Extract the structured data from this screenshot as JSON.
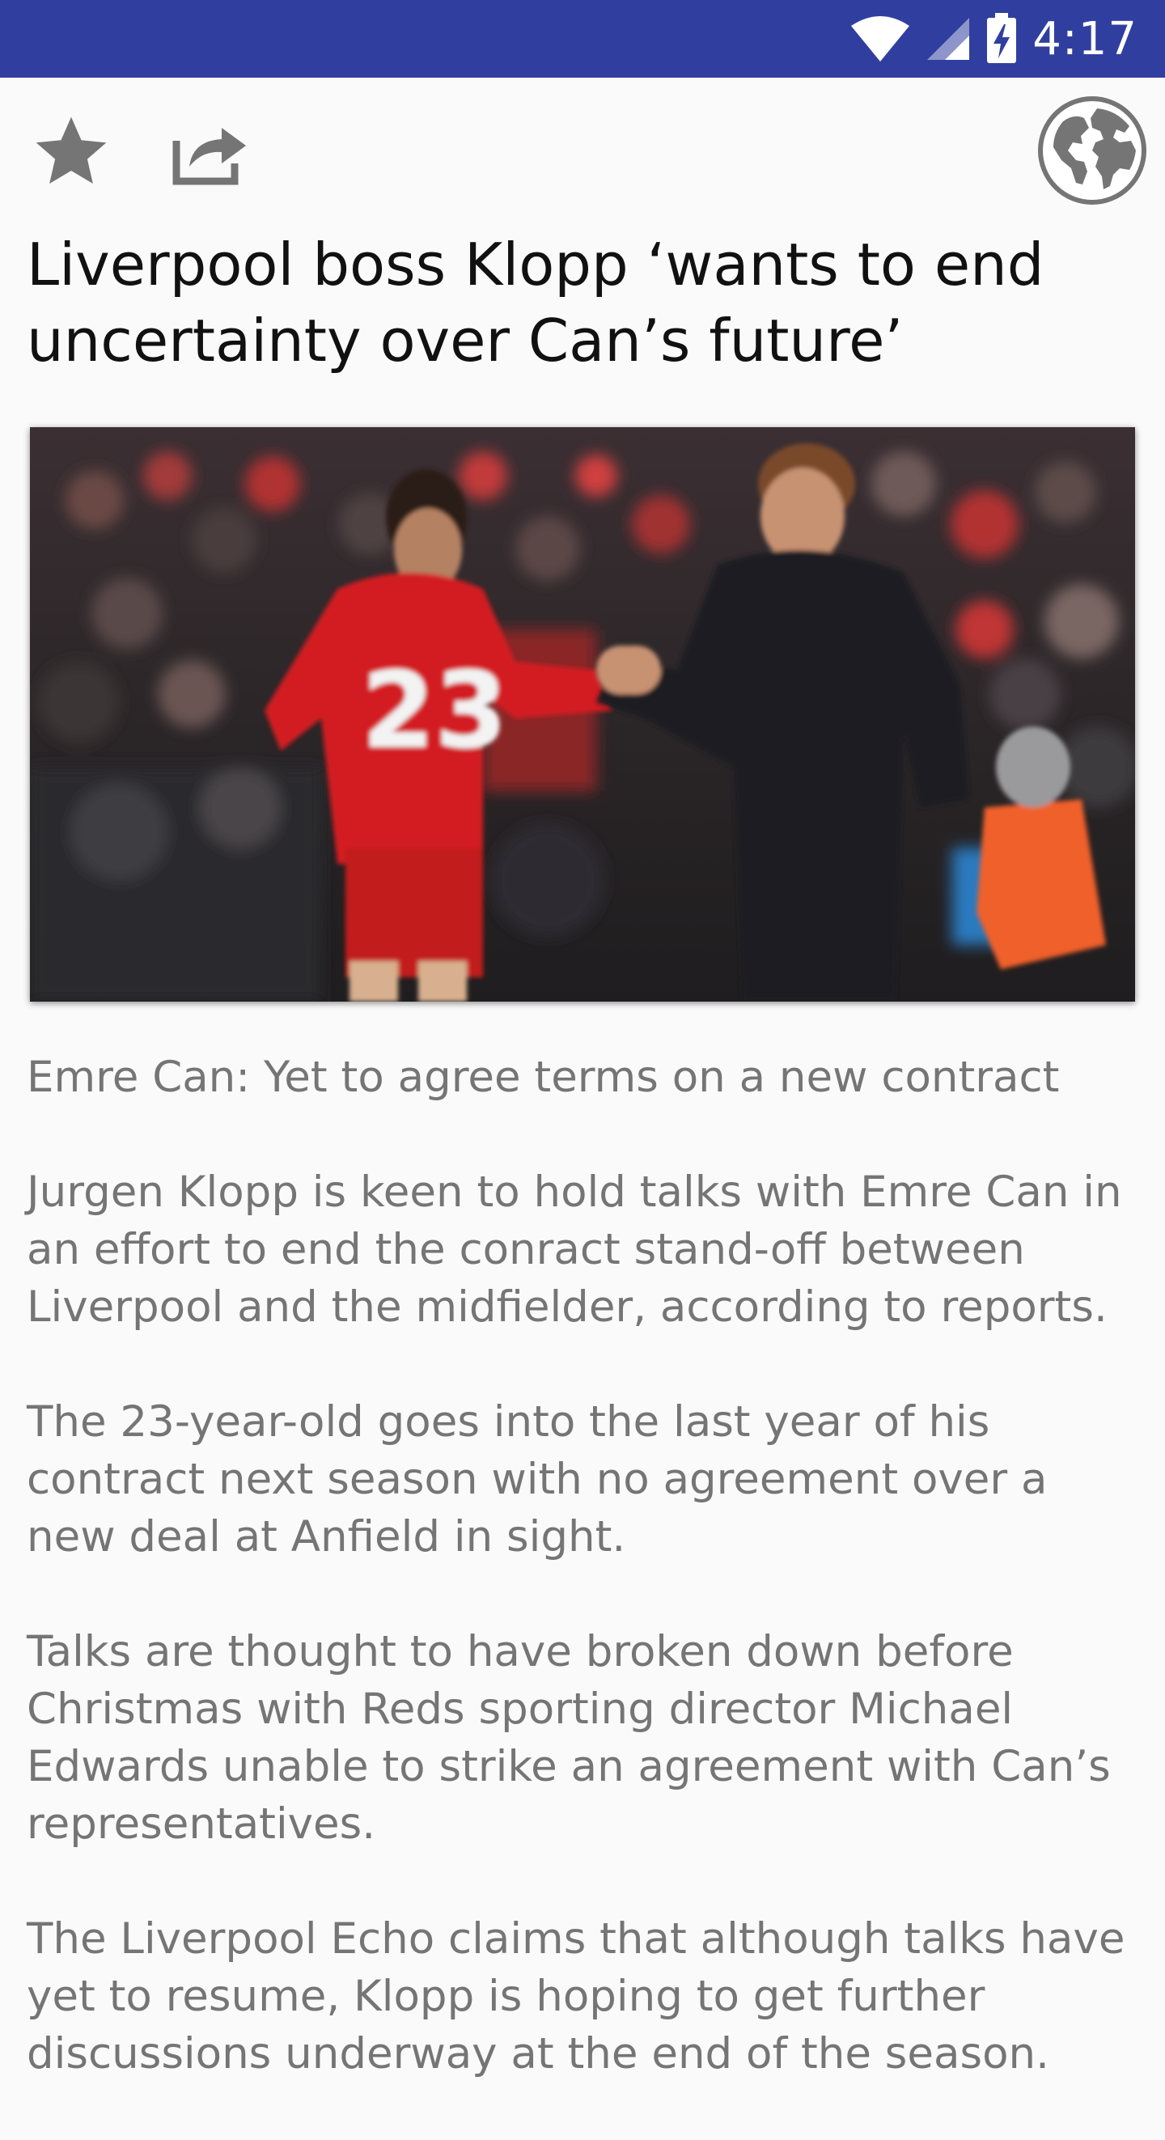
{
  "status_bar": {
    "time": "4:17",
    "icons": [
      "wifi-icon",
      "cellular-signal-icon",
      "battery-charging-icon"
    ],
    "background_color": "#303f9f"
  },
  "toolbar": {
    "favorite_icon": "star-icon",
    "share_icon": "share-icon",
    "open_in_browser_icon": "globe-icon",
    "icon_color": "#757575"
  },
  "article": {
    "headline": "Liverpool boss Klopp ‘wants to end uncertainty over Can’s future’",
    "image": {
      "description_icon": "news-photo",
      "jersey_number": "23"
    },
    "paragraphs": [
      "Emre Can: Yet to agree terms on a new contract",
      "Jurgen Klopp is keen to hold talks with Emre Can in an effort to end the conract stand-off between Liverpool and the midfielder, according to reports.",
      "The 23-year-old goes into the last year of his contract next season with no agreement over a new deal at Anfield in sight.",
      "Talks are thought to have broken down before Christmas with Reds sporting director Michael Edwards unable to strike an agreement with Can’s representatives.",
      "The Liverpool Echo claims that although talks have yet to resume, Klopp is hoping to get further discussions underway at the end of the season."
    ],
    "text_color": "#757575"
  }
}
